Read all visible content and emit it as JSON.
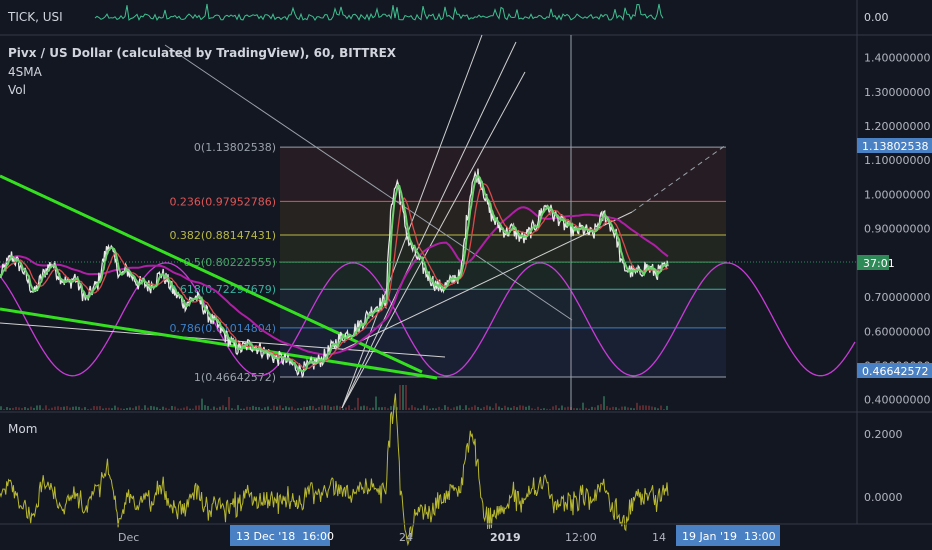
{
  "tick_pane": {
    "title": "TICK, USI",
    "value_label": "0.00"
  },
  "main_pane": {
    "title": "Pivx / US Dollar (calculated by TradingView), 60, BITTREX",
    "indicator_1": "4SMA",
    "indicator_2": "Vol",
    "price_badges": {
      "high": "1.13802538",
      "low": "0.46642572",
      "countdown": "37:01"
    }
  },
  "mom_pane": {
    "title": "Mom"
  },
  "time_axis": {
    "labels": [
      "Dec",
      "24",
      "2019",
      "12:00",
      "14"
    ],
    "crosshair_badges": [
      "13 Dec '18  16:00",
      "19 Jan '19  13:00"
    ]
  },
  "colors": {
    "background": "#131722",
    "candle_line": "#e8e8e8",
    "sma": "#6bd16b",
    "ma2": "#d84a4a",
    "long_ma": "#b01fa6",
    "cycle": "#c93bd8",
    "channel": "#34e01f",
    "fib_top": "#9aa0aa",
    "fib_0236": "#e05555",
    "fib_0382": "#b8b845",
    "fib_05": "#4ca66a",
    "fib_0618": "#38b0a0",
    "fib_0786": "#3d7fc4",
    "fib_1": "#9aa0aa",
    "momentum": "#b8b830",
    "tick_line": "#3fbf8f",
    "axis_badge": "#4a80c4",
    "countdown_badge": "#2e8b57"
  },
  "chart_data": [
    {
      "type": "line",
      "name": "TICK, USI",
      "y_ticks": [
        "0.00"
      ]
    },
    {
      "type": "line",
      "name": "Pivx / US Dollar",
      "y_ticks": [
        "1.40000000",
        "1.30000000",
        "1.20000000",
        "1.10000000",
        "1.00000000",
        "0.90000000",
        "0.70000000",
        "0.60000000",
        "0.50000000",
        "0.40000000"
      ],
      "ylim": [
        0.37,
        1.46
      ],
      "price_series": [
        0.76,
        0.79,
        0.82,
        0.8,
        0.78,
        0.74,
        0.71,
        0.75,
        0.78,
        0.8,
        0.77,
        0.75,
        0.74,
        0.76,
        0.72,
        0.69,
        0.72,
        0.74,
        0.81,
        0.86,
        0.8,
        0.76,
        0.78,
        0.76,
        0.74,
        0.74,
        0.73,
        0.75,
        0.77,
        0.75,
        0.72,
        0.7,
        0.68,
        0.69,
        0.7,
        0.68,
        0.65,
        0.63,
        0.61,
        0.59,
        0.57,
        0.55,
        0.55,
        0.56,
        0.56,
        0.55,
        0.54,
        0.53,
        0.52,
        0.52,
        0.51,
        0.5,
        0.49,
        0.49,
        0.5,
        0.51,
        0.52,
        0.54,
        0.56,
        0.58,
        0.59,
        0.6,
        0.61,
        0.63,
        0.65,
        0.67,
        0.68,
        0.69,
        0.98,
        1.04,
        0.94,
        0.86,
        0.83,
        0.8,
        0.77,
        0.75,
        0.73,
        0.73,
        0.74,
        0.76,
        0.76,
        0.92,
        1.04,
        1.06,
        1.01,
        0.95,
        0.92,
        0.9,
        0.89,
        0.9,
        0.88,
        0.87,
        0.89,
        0.91,
        0.95,
        0.97,
        0.94,
        0.93,
        0.91,
        0.9,
        0.89,
        0.9,
        0.89,
        0.88,
        0.92,
        0.94,
        0.91,
        0.88,
        0.79,
        0.78,
        0.77,
        0.77,
        0.79,
        0.78,
        0.77,
        0.78,
        0.79
      ],
      "fibonacci_levels": [
        {
          "label": "0(1.13802538)",
          "ratio": 0,
          "price": 1.13802538
        },
        {
          "label": "0.236(0.97952786)",
          "ratio": 0.236,
          "price": 0.97952786
        },
        {
          "label": "0.382(0.88147431)",
          "ratio": 0.382,
          "price": 0.88147431
        },
        {
          "label": "0.5(0.80222555)",
          "ratio": 0.5,
          "price": 0.80222555
        },
        {
          "label": "0.618(0.72297679)",
          "ratio": 0.618,
          "price": 0.72297679
        },
        {
          "label": "0.786(0.61014804)",
          "ratio": 0.786,
          "price": 0.61014804
        },
        {
          "label": "1(0.46642572)",
          "ratio": 1,
          "price": 0.46642572
        }
      ],
      "sine_cycle": {
        "low": 0.47,
        "high": 0.8
      }
    },
    {
      "type": "line",
      "name": "Mom",
      "y_ticks": [
        "0.2000",
        "0.0000"
      ],
      "ylim": [
        -0.08,
        0.26
      ]
    }
  ]
}
